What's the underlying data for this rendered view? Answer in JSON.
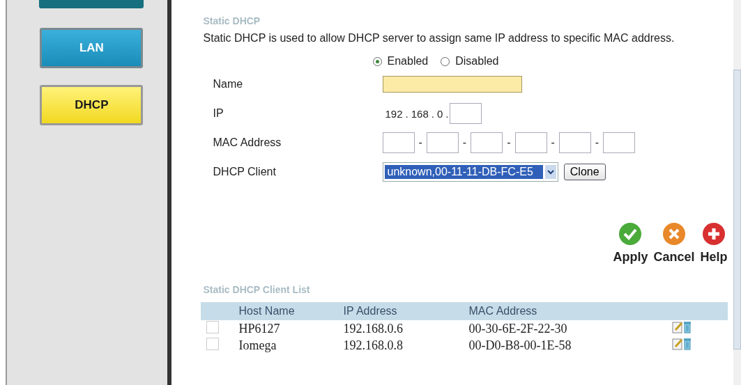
{
  "sidebar": {
    "items": [
      {
        "label": "LAN",
        "selected": false
      },
      {
        "label": "DHCP",
        "selected": true
      }
    ]
  },
  "static_dhcp": {
    "title": "Static DHCP",
    "description": "Static DHCP is used to allow DHCP server to assign same IP address to specific MAC address.",
    "mode": [
      {
        "label": "Enabled",
        "selected": true
      },
      {
        "label": "Disabled",
        "selected": false
      }
    ],
    "name_label": "Name",
    "ip_label": "IP",
    "ip_prefix": [
      "192",
      ".",
      "168",
      ".",
      "0",
      "."
    ],
    "mac_label": "MAC Address",
    "mac_separators": [
      "-",
      "-",
      "-",
      "-",
      "-"
    ],
    "client_label": "DHCP Client",
    "client_value": "unknown,00-11-11-DB-FC-E5",
    "clone": "Clone"
  },
  "actions": [
    {
      "kind": "apply",
      "label": "Apply"
    },
    {
      "kind": "cancel",
      "label": "Cancel"
    },
    {
      "kind": "help",
      "label": "Help"
    }
  ],
  "client_list": {
    "title": "Static DHCP Client List",
    "columns": [
      "Host Name",
      "IP Address",
      "MAC Address"
    ],
    "rows": [
      {
        "checked": false,
        "cells": [
          "HP6127",
          "192.168.0.6",
          "00-30-6E-2F-22-30"
        ]
      },
      {
        "checked": false,
        "cells": [
          "Iomega",
          "192.168.0.8",
          "00-D0-B8-00-1E-58"
        ]
      }
    ]
  }
}
